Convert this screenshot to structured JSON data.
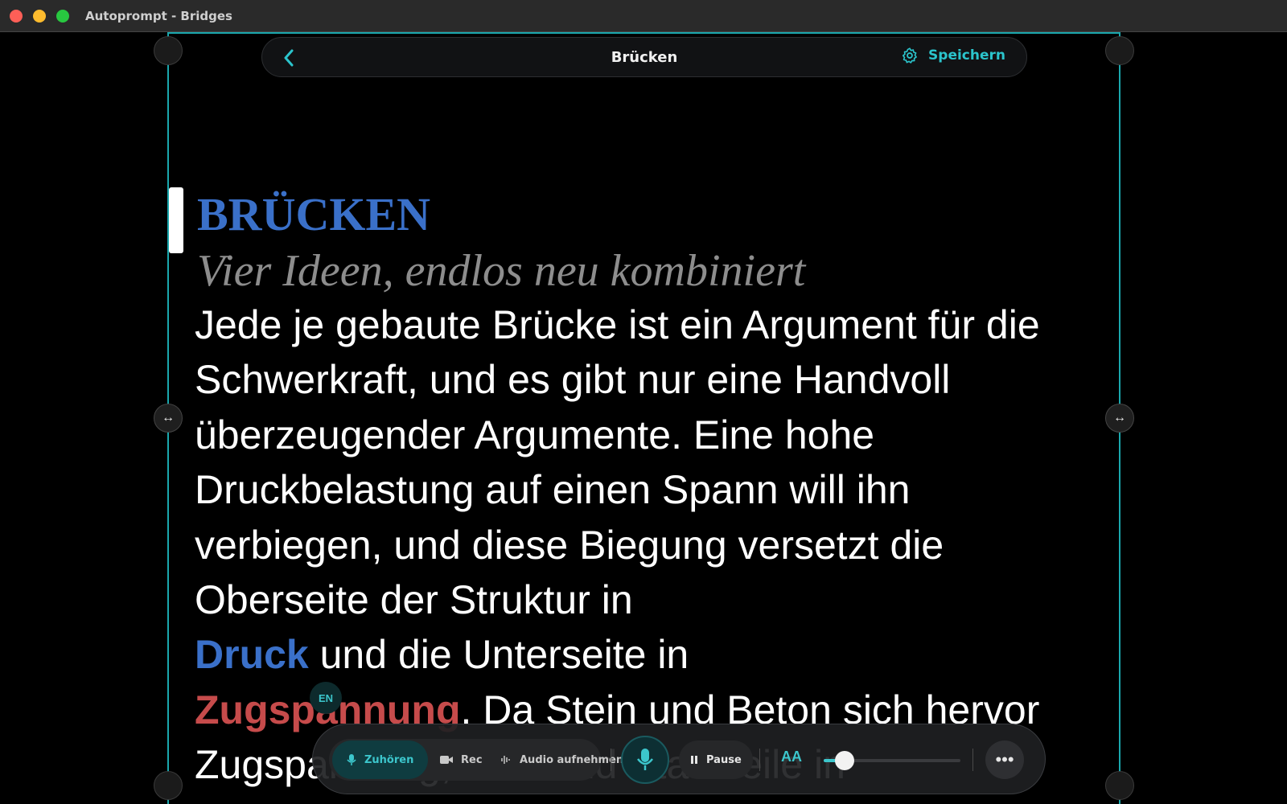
{
  "window": {
    "title": "Autoprompt - Bridges"
  },
  "topbar": {
    "doc_title": "Brücken",
    "save_label": "Speichern"
  },
  "document": {
    "heading": "BRÜCKEN",
    "subheading": "Vier Ideen, endlos neu kombiniert",
    "para1": "Jede je gebaute Brücke ist ein Argument für die Schwerkraft, und es gibt nur eine Handvoll überzeugender Argumente. Eine hohe Druckbelastung auf einen Spann will ihn verbiegen, und diese Biegung versetzt die Oberseite der Struktur in",
    "term_druck": "Druck",
    "text_after_druck": " und die Unterseite in",
    "term_zug": "Zugspannung",
    "text_after_zug": ". Da Stein und Beton sich hervor",
    "partial_line": "Zugspannung, während Stahlseile in"
  },
  "lang_badge": "EN",
  "toolbar": {
    "listen_label": "Zuhören",
    "rec_label": "Rec",
    "audio_label": "Audio aufnehmen",
    "pause_label": "Pause",
    "font_size_label": "AA",
    "font_size_level": 0.15
  },
  "colors": {
    "accent": "#2bc4cc",
    "heading": "#3a70c9",
    "term_compression": "#3a70c9",
    "term_tension": "#c64b4b"
  }
}
